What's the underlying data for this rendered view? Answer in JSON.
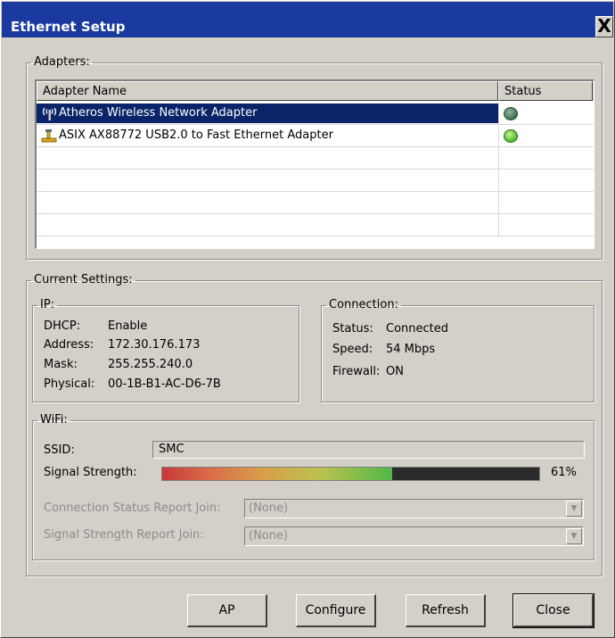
{
  "window": {
    "title": "Ethernet Setup",
    "close_glyph": "X"
  },
  "adapters": {
    "group_label": "Adapters:",
    "columns": [
      "Adapter Name",
      "Status"
    ],
    "rows": [
      {
        "name": "Atheros Wireless Network Adapter",
        "icon": "wireless-icon",
        "status_color": "#3f6f52",
        "selected": true
      },
      {
        "name": "ASIX AX88772 USB2.0 to Fast Ethernet Adapter",
        "icon": "ethernet-icon",
        "status_color": "#5fd13a",
        "selected": false
      }
    ]
  },
  "current_settings": {
    "group_label": "Current Settings:",
    "ip": {
      "group_label": "IP:",
      "dhcp_label": "DHCP:",
      "dhcp_value": "Enable",
      "address_label": "Address:",
      "address_value": "172.30.176.173",
      "mask_label": "Mask:",
      "mask_value": "255.255.240.0",
      "physical_label": "Physical:",
      "physical_value": "00-1B-B1-AC-D6-7B"
    },
    "connection": {
      "group_label": "Connection:",
      "status_label": "Status:",
      "status_value": "Connected",
      "speed_label": "Speed:",
      "speed_value": "54 Mbps",
      "firewall_label": "Firewall:",
      "firewall_value": "ON"
    },
    "wifi": {
      "group_label": "WiFi:",
      "ssid_label": "SSID:",
      "ssid_value": "SMC",
      "signal_label": "Signal Strength:",
      "signal_percent": 61,
      "signal_text": "61%",
      "conn_report_label": "Connection Status Report Join:",
      "conn_report_value": "(None)",
      "signal_report_label": "Signal Strength Report Join:",
      "signal_report_value": "(None)"
    }
  },
  "buttons": {
    "ap": "AP",
    "configure": "Configure",
    "refresh": "Refresh",
    "close": "Close"
  }
}
